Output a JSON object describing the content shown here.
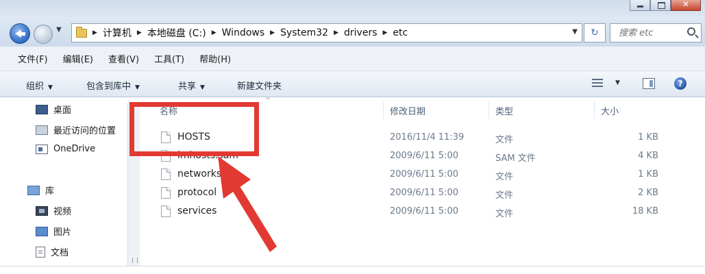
{
  "window": {
    "controls": {
      "minimize_icon": "minimize-icon",
      "maximize_icon": "maximize-icon",
      "close_icon": "close-icon"
    }
  },
  "address_bar": {
    "breadcrumbs": [
      "计算机",
      "本地磁盘 (C:)",
      "Windows",
      "System32",
      "drivers",
      "etc"
    ],
    "search_placeholder": "搜索 etc"
  },
  "menu": {
    "items": [
      "文件(F)",
      "编辑(E)",
      "查看(V)",
      "工具(T)",
      "帮助(H)"
    ]
  },
  "commands": {
    "organize": "组织",
    "include_in_library": "包含到库中",
    "share": "共享",
    "new_folder": "新建文件夹"
  },
  "nav_pane": {
    "items": [
      {
        "label": "桌面",
        "icon": "desktop-icon"
      },
      {
        "label": "最近访问的位置",
        "icon": "recent-places-icon"
      },
      {
        "label": "OneDrive",
        "icon": "onedrive-icon"
      },
      {
        "label": "库",
        "icon": "library-icon"
      },
      {
        "label": "视频",
        "icon": "video-icon"
      },
      {
        "label": "图片",
        "icon": "picture-icon"
      },
      {
        "label": "文档",
        "icon": "document-icon"
      }
    ]
  },
  "file_list": {
    "columns": [
      "名称",
      "修改日期",
      "类型",
      "大小"
    ],
    "rows": [
      {
        "name": "HOSTS",
        "modified": "2016/11/4 11:39",
        "type": "文件",
        "size": "1 KB"
      },
      {
        "name": "lmhosts.sam",
        "modified": "2009/6/11 5:00",
        "type": "SAM 文件",
        "size": "4 KB"
      },
      {
        "name": "networks",
        "modified": "2009/6/11 5:00",
        "type": "文件",
        "size": "1 KB"
      },
      {
        "name": "protocol",
        "modified": "2009/6/11 5:00",
        "type": "文件",
        "size": "2 KB"
      },
      {
        "name": "services",
        "modified": "2009/6/11 5:00",
        "type": "文件",
        "size": "18 KB"
      }
    ]
  },
  "annotation": {
    "color": "#e23a33"
  }
}
